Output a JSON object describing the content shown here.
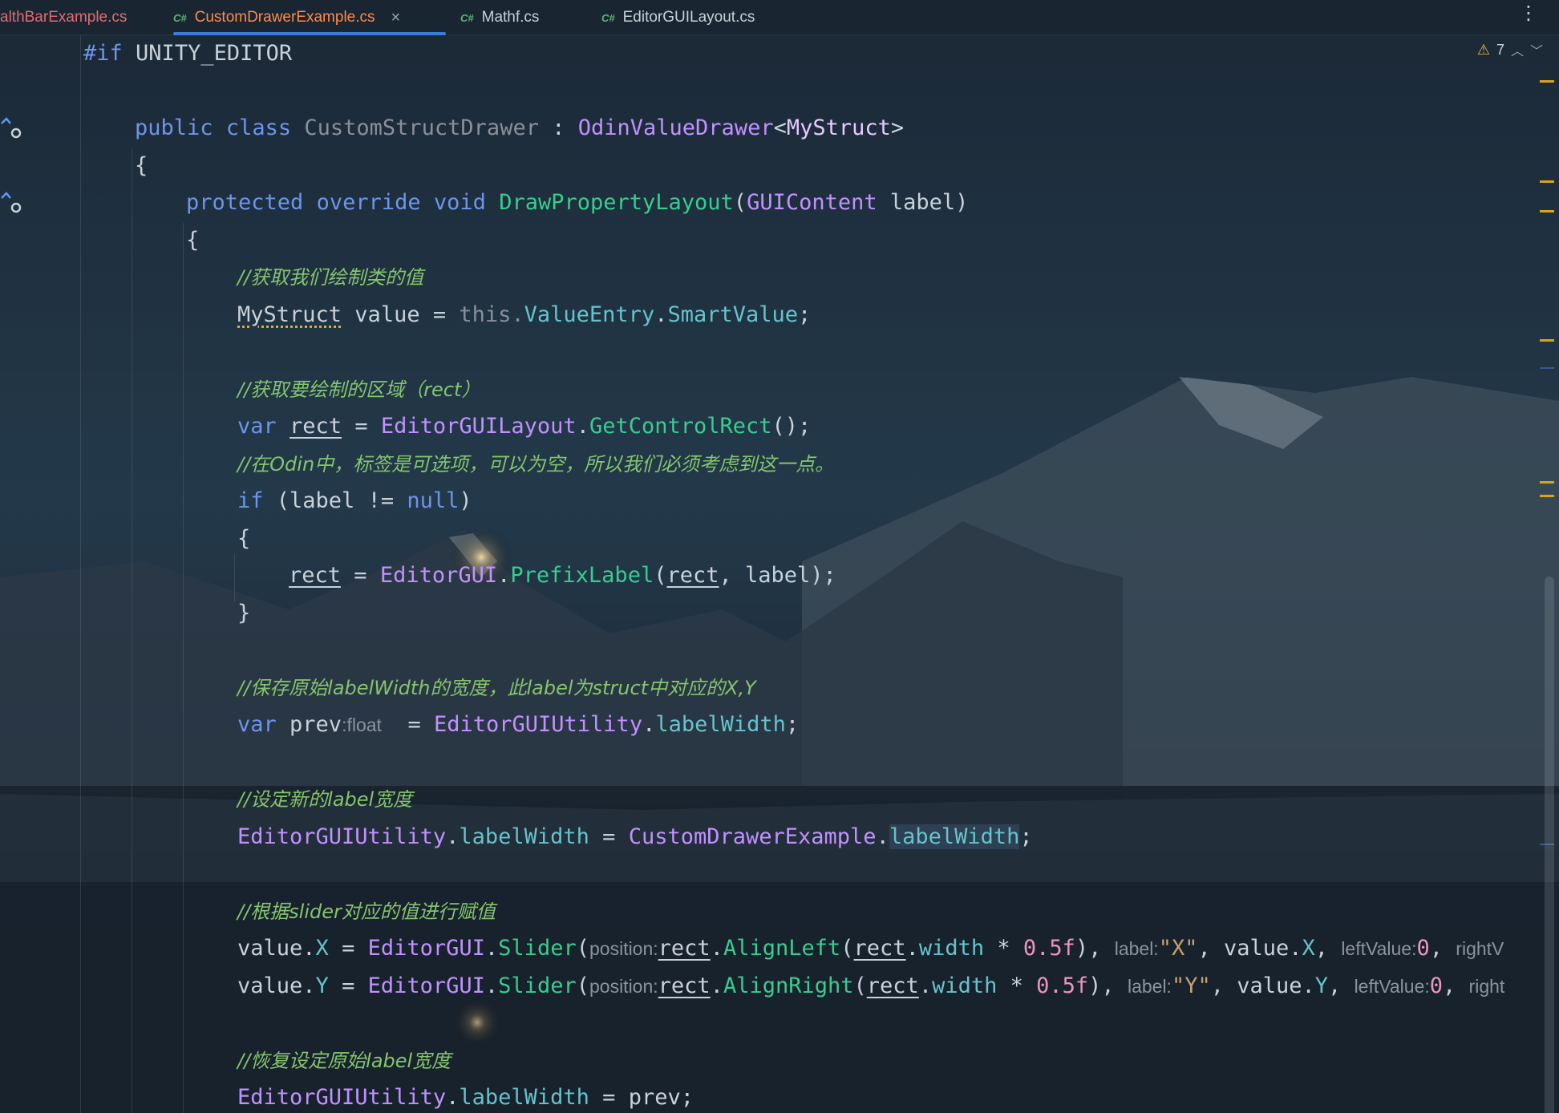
{
  "tabs": [
    {
      "name": "althBarExample.cs",
      "icon": "csharp-file-icon"
    },
    {
      "name": "CustomDrawerExample.cs",
      "icon": "csharp-file-icon",
      "active": true
    },
    {
      "name": "Mathf.cs",
      "icon": "csharp-file-icon"
    },
    {
      "name": "EditorGUILayout.cs",
      "icon": "csharp-file-icon"
    }
  ],
  "tab_icon_text": "C#",
  "close_glyph": "×",
  "menu_glyph": "⋮",
  "warnings": {
    "count": "7",
    "icon": "warning-icon"
  },
  "colors": {
    "keyword": "#6c95eb",
    "class": "#c191ff",
    "method": "#39cc8f",
    "field": "#66c3cc",
    "number": "#ed94c0",
    "string": "#c9a26d",
    "comment": "#85c46c",
    "active_tab": "#ff8a4c",
    "warning": "#e5b93a"
  },
  "code": {
    "directive": "#if",
    "symbol": "UNITY_EDITOR",
    "l_public": "public",
    "l_class": "class",
    "l_classname": "CustomStructDrawer",
    "l_colon": " : ",
    "l_base": "OdinValueDrawer",
    "l_lt": "<",
    "l_struct": "MyStruct",
    "l_gt": ">",
    "brace_open": "{",
    "brace_close": "}",
    "l_protected": "protected",
    "l_override": "override",
    "l_void": "void",
    "l_method": "DrawPropertyLayout",
    "l_paren_open": "(",
    "l_guicontent": "GUIContent",
    "l_label_param": " label)",
    "c1": "//获取我们绘制类的值",
    "l_mystruct": "MyStruct",
    "l_value_eq": " value = ",
    "l_this": "this.",
    "l_valueentry": "ValueEntry",
    "l_dot": ".",
    "l_smartvalue": "SmartValue",
    "l_semi": ";",
    "c2": "//获取要绘制的区域（rect）",
    "l_var": "var",
    "l_rect": "rect",
    "l_eq": " = ",
    "l_editorguilayout": "EditorGUILayout",
    "l_getcontrolrect": "GetControlRect",
    "l_callend": "();",
    "c3": "//在Odin中，标签是可选项，可以为空，所以我们必须考虑到这一点。",
    "l_if": "if",
    "l_cond": " (label != ",
    "l_null": "null",
    "l_close_paren": ")",
    "l_editorgui": "EditorGUI",
    "l_prefixlabel": "PrefixLabel",
    "l_prefix_args_end": ", label);",
    "c4": "//保存原始labelWidth的宽度，此label为struct中对应的X,Y",
    "l_prev": " prev",
    "l_hint_float": ":float",
    "l_editorguiutility": "EditorGUIUtility",
    "l_labelwidth": "labelWidth",
    "c5": "//设定新的label宽度",
    "l_customdrawerexample": "CustomDrawerExample",
    "c6": "//根据slider对应的值进行赋值",
    "l_value": "value",
    "l_x": "X",
    "l_y": "Y",
    "l_slider": "Slider",
    "l_hint_position": "position:",
    "l_alignleft": "AlignLeft",
    "l_alignright": "AlignRight",
    "l_width": "width",
    "l_times": " * ",
    "l_half": "0.5f",
    "l_close_comma": "), ",
    "l_hint_label": "label:",
    "l_str_x": "\"X\"",
    "l_str_y": "\"Y\"",
    "l_comma": ", ",
    "l_hint_leftvalue": "leftValue:",
    "l_zero": "0",
    "l_hint_rightv": "rightV",
    "l_hint_right": "right",
    "c7": "//恢复设定原始label宽度",
    "l_eq_prev": " = prev;"
  }
}
